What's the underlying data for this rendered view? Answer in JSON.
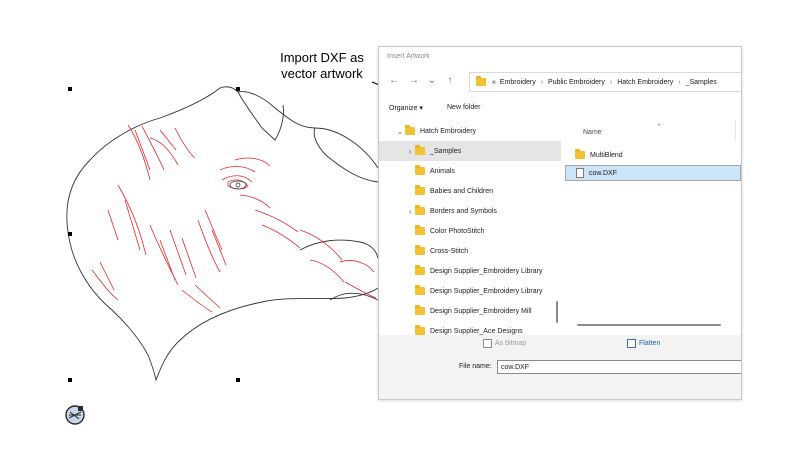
{
  "callout": {
    "line1": "Import DXF as",
    "line2": "vector artwork"
  },
  "dialog": {
    "title": "Insert Artwork",
    "breadcrumb": [
      "«",
      "Embroidery",
      "Public Embroidery",
      "Hatch Embroidery",
      "_Samples"
    ],
    "toolbar": {
      "organize": "Organize ▾",
      "new_folder": "New folder"
    },
    "tree": [
      {
        "label": "Hatch Embroidery",
        "chevron": "⌄",
        "indent": 1,
        "selected": false
      },
      {
        "label": "_Samples",
        "chevron": "›",
        "indent": 2,
        "selected": true
      },
      {
        "label": "Animals",
        "chevron": "",
        "indent": 2,
        "selected": false
      },
      {
        "label": "Babies and Children",
        "chevron": "",
        "indent": 2,
        "selected": false
      },
      {
        "label": "Borders and Symbols",
        "chevron": "›",
        "indent": 2,
        "selected": false
      },
      {
        "label": "Color PhotoStitch",
        "chevron": "",
        "indent": 2,
        "selected": false
      },
      {
        "label": "Cross-Stitch",
        "chevron": "",
        "indent": 2,
        "selected": false
      },
      {
        "label": "Design Supplier_Embroidery Library",
        "chevron": "",
        "indent": 2,
        "selected": false
      },
      {
        "label": "Design Supplier_Embroidery Library",
        "chevron": "",
        "indent": 2,
        "selected": false
      },
      {
        "label": "Design Supplier_Embroidery Mill",
        "chevron": "",
        "indent": 2,
        "selected": false
      },
      {
        "label": "Design Supplier_Ace Designs",
        "chevron": "",
        "indent": 2,
        "selected": false
      }
    ],
    "files": {
      "column_name": "Name",
      "items": [
        {
          "label": "MultiBlend",
          "type": "folder",
          "selected": false
        },
        {
          "label": "cow.DXF",
          "type": "file",
          "selected": true
        }
      ]
    },
    "options": {
      "as_bitmap": "As bitmap",
      "flatten": "Flatten"
    },
    "file_name": {
      "label": "File name:",
      "value": "cow.DXF"
    }
  },
  "colors": {
    "outline": "#333333",
    "detail": "#e8262b",
    "folder": "#f2c233",
    "accent": "#1f5ebf"
  }
}
